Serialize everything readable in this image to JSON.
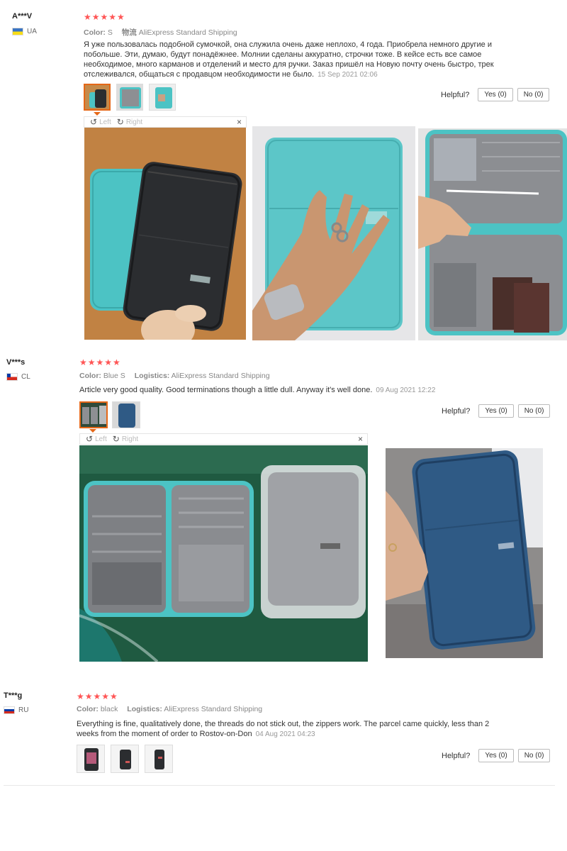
{
  "reviews": [
    {
      "user": "A***V",
      "country": "UA",
      "stars": "★★★★★",
      "color_label": "Color:",
      "color_value": "S",
      "logistics_label": "物流",
      "logistics_value": "AliExpress Standard Shipping",
      "text": "Я уже пользовалась подобной сумочкой, она служила очень даже неплохо, 4 года. Приобрела немного другие и побольше. Эти, думаю, будут понадёжнее. Молнии сделаны аккуратно, строчки тоже. В кейсе есть все самое необходимое, много карманов и отделений и место для ручки. Заказ пришёл на Новую почту очень быстро, трек отслеживался, общаться с продавцом необходимости не было.",
      "date": "15 Sep 2021 02:06",
      "helpful_label": "Helpful?",
      "yes": "Yes (0)",
      "no": "No (0)",
      "viewer_left": "Left",
      "viewer_right": "Right",
      "viewer_close": "×"
    },
    {
      "user": "V***s",
      "country": "CL",
      "stars": "★★★★★",
      "color_label": "Color:",
      "color_value": "Blue S",
      "logistics_label": "Logistics:",
      "logistics_value": "AliExpress Standard Shipping",
      "text": "Article very good quality. Good terminations though a little dull. Anyway it's well done.",
      "date": "09 Aug 2021 12:22",
      "helpful_label": "Helpful?",
      "yes": "Yes (0)",
      "no": "No (0)",
      "viewer_left": "Left",
      "viewer_right": "Right",
      "viewer_close": "×"
    },
    {
      "user": "T***g",
      "country": "RU",
      "stars": "★★★★★",
      "color_label": "Color:",
      "color_value": "black",
      "logistics_label": "Logistics:",
      "logistics_value": "AliExpress Standard Shipping",
      "text": "Everything is fine, qualitatively done, the threads do not stick out, the zippers work. The parcel came quickly, less than 2 weeks from the moment of order to Rostov-on-Don",
      "date": "04 Aug 2021 04:23",
      "helpful_label": "Helpful?",
      "yes": "Yes (0)",
      "no": "No (0)"
    }
  ],
  "colors": {
    "star": "#ff5555",
    "active_border": "#e56717",
    "teal_bag": "#4cc3c4",
    "black_bag": "#2b2d30",
    "grey_bag": "#9a9ca0",
    "navy_bag": "#2f5a85"
  }
}
